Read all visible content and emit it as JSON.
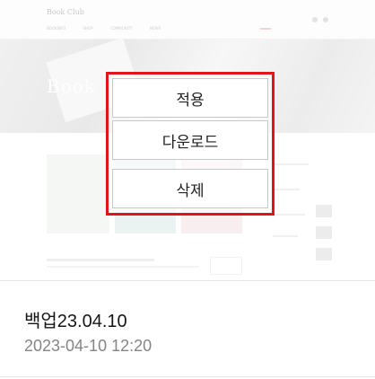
{
  "menu": {
    "apply_label": "적용",
    "download_label": "다운로드",
    "delete_label": "삭제"
  },
  "backup": {
    "name": "백업23.04.10",
    "date": "2023-04-10 12:20"
  },
  "preview": {
    "site_title": "Book Club",
    "hero_title": "Book",
    "nav_items": [
      "BOOKINFO",
      "SHOP",
      "COMMUNITY",
      "NEWS"
    ]
  },
  "colors": {
    "highlight_border": "#e2141b"
  }
}
